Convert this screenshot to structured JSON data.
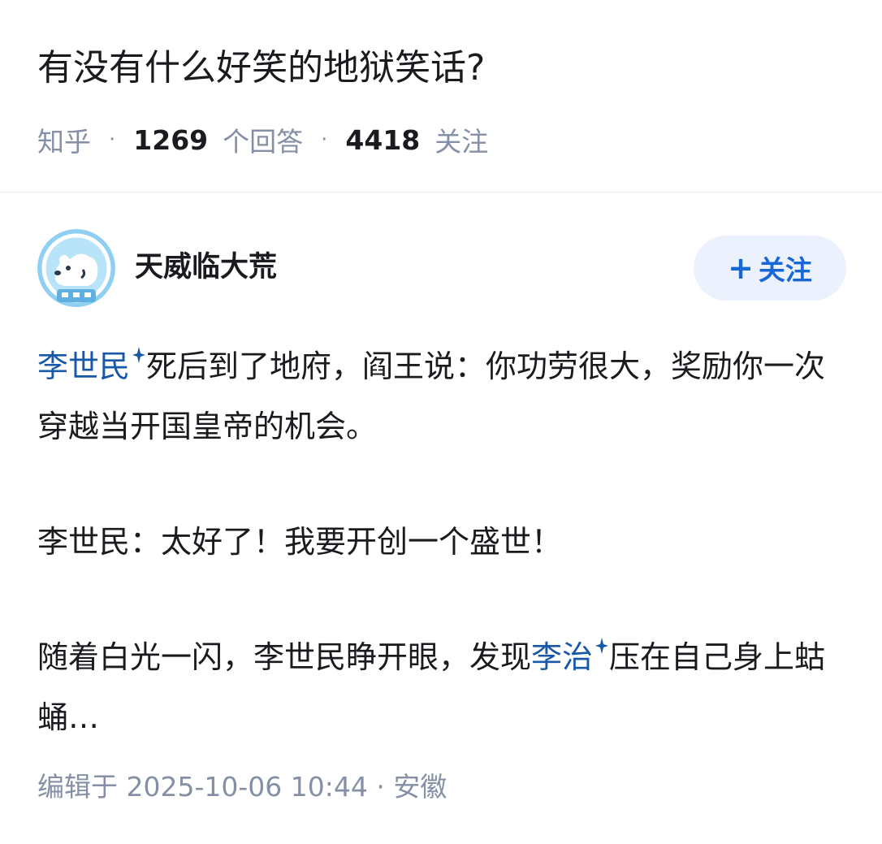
{
  "question": {
    "title": "有没有什么好笑的地狱笑话?",
    "source": "知乎",
    "answer_count": "1269",
    "answer_label": "个回答",
    "follower_count": "4418",
    "follower_label": "关注"
  },
  "author": {
    "name": "天威临大荒",
    "avatar_icon": "polar-bear-astronaut-avatar",
    "follow_label": "关注",
    "follow_icon": "plus-icon"
  },
  "answer": {
    "p1_link": "李世民",
    "p1_text": "死后到了地府，阎王说：你功劳很大，奖励你一次穿越当开国皇帝的机会。",
    "p2_text": "李世民：太好了！我要开创一个盛世！",
    "p3_text_a": "随着白光一闪，李世民睁开眼，发现",
    "p3_link": "李治",
    "p3_text_b": "压在自己身上蛄蛹…",
    "edited": "编辑于 2025-10-06 10:44 · 安徽"
  },
  "colors": {
    "link": "#1758a8",
    "accent": "#1767d6",
    "follow_bg": "#ebf2fd",
    "muted": "#8590a6",
    "text": "#191b1f"
  }
}
